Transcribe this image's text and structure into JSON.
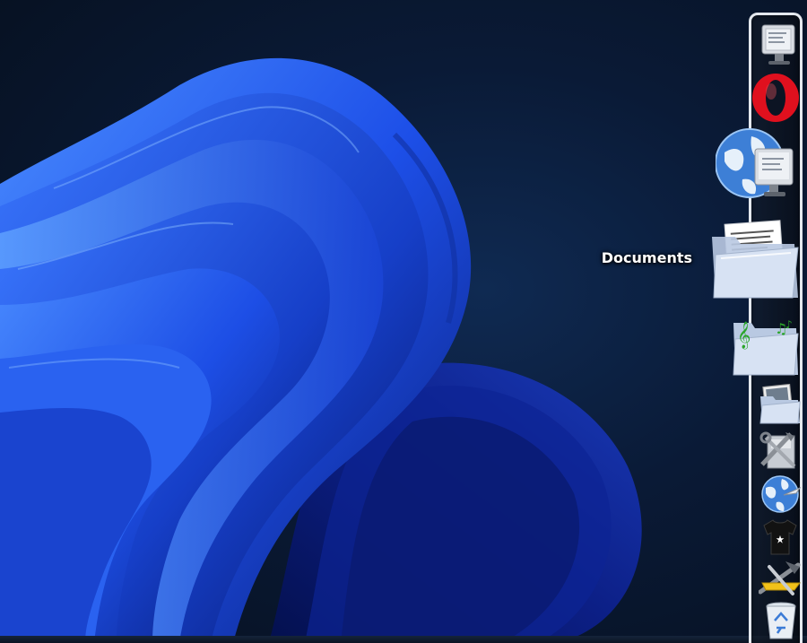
{
  "desktop": {
    "wallpaper": "windows-11-bloom",
    "colors": {
      "background": "#0a1a36",
      "bloom": "#1f4be0",
      "bloom_light": "#3a7cff"
    }
  },
  "dock": {
    "hover_label": "Documents",
    "items": [
      {
        "name": "computer-icon"
      },
      {
        "name": "opera-icon"
      },
      {
        "name": "network-icon"
      },
      {
        "name": "documents-folder-icon"
      },
      {
        "name": "music-folder-icon"
      },
      {
        "name": "pictures-folder-icon"
      },
      {
        "name": "system-tools-icon"
      },
      {
        "name": "internet-icon"
      },
      {
        "name": "tshirt-icon"
      },
      {
        "name": "tools-icon"
      },
      {
        "name": "recycle-bin-icon"
      }
    ]
  }
}
